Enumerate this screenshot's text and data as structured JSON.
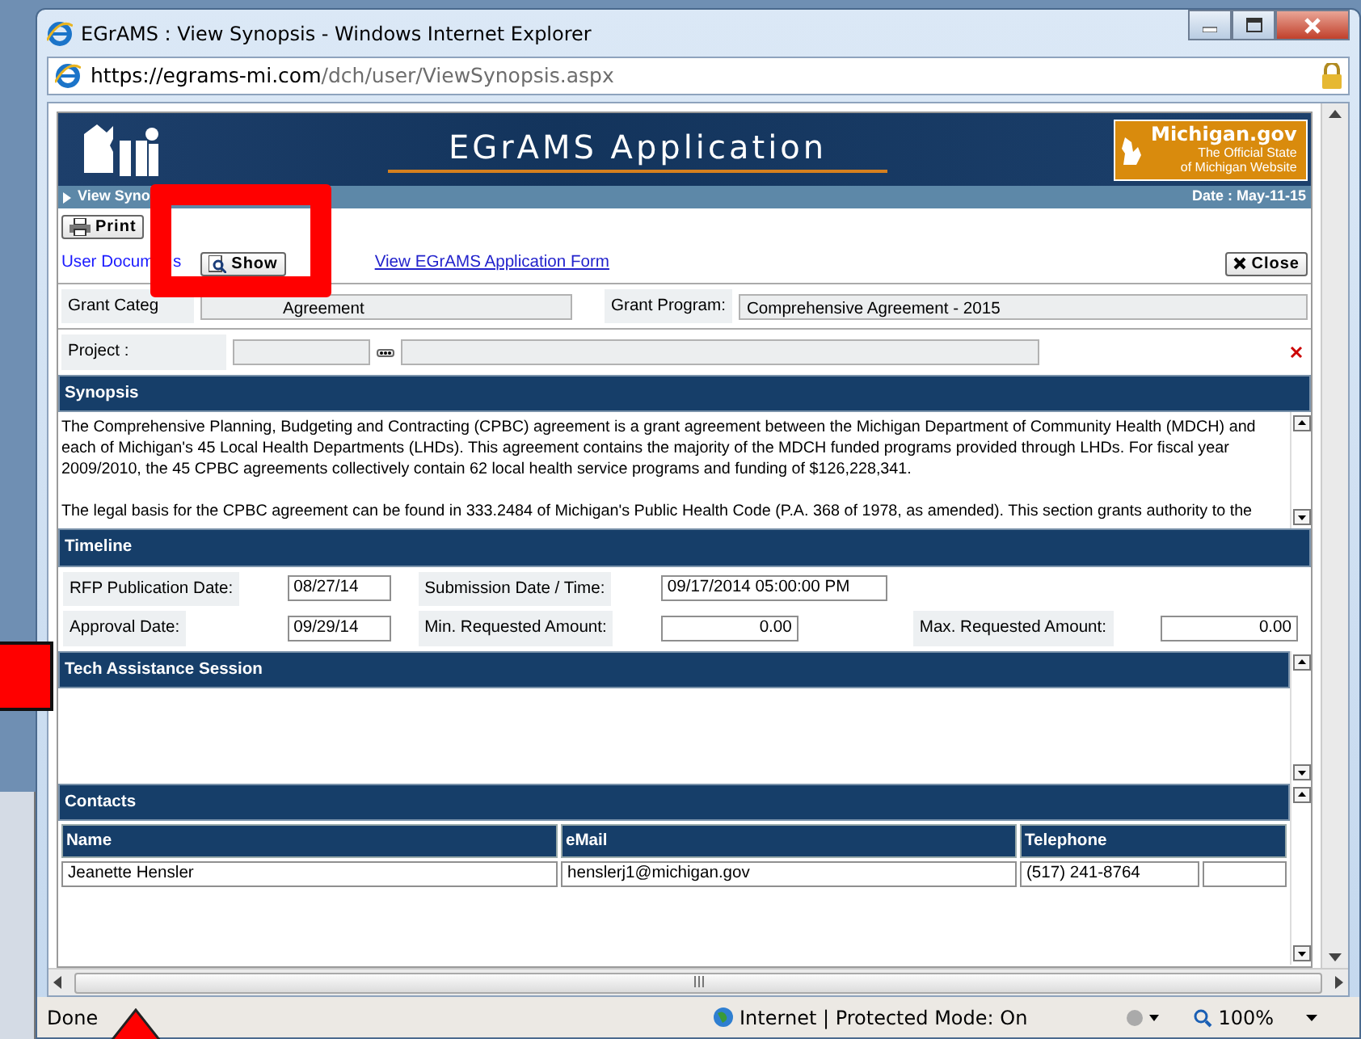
{
  "window": {
    "title": "EGrAMS : View Synopsis - Windows Internet Explorer",
    "address_host": "https://egrams-mi.com",
    "address_path": "/dch/user/ViewSynopsis.aspx"
  },
  "banner": {
    "title": "EGrAMS Application",
    "logo_title": "Michigan.gov",
    "logo_lines": [
      "The Official State",
      "of Michigan Website"
    ]
  },
  "subbar": {
    "page": "View Syno",
    "date": "Date : May-11-15"
  },
  "toolbar": {
    "print": "Print",
    "user_documents": "User Docum",
    "user_documents_tail": "s",
    "show": "Show",
    "form_link": "View EGrAMS Application Form",
    "close": "Close"
  },
  "grant": {
    "category_label": "Grant Categ",
    "category_value": "Agreement",
    "program_label": "Grant Program:",
    "program_value": "Comprehensive Agreement - 2015"
  },
  "project": {
    "label": "Project :"
  },
  "synopsis": {
    "heading": "Synopsis",
    "paragraphs": [
      "The Comprehensive Planning, Budgeting and Contracting (CPBC) agreement is a grant agreement between the Michigan Department of Community Health (MDCH) and each of Michigan's 45 Local Health Departments (LHDs). This agreement contains the majority of the MDCH funded programs provided through LHDs. For fiscal year 2009/2010, the 45 CPBC agreements collectively contain 62 local health service programs and funding of $126,228,341.",
      "The legal basis for the CPBC agreement can be found in 333.2484 of Michigan's Public Health Code (P.A. 368 of 1978, as amended). This section grants authority to the"
    ]
  },
  "timeline": {
    "heading": "Timeline",
    "rows": [
      [
        {
          "label": "RFP Publication Date:",
          "value": "08/27/14",
          "kind": "date"
        },
        {
          "label": "Submission Date / Time:",
          "value": "09/17/2014 05:00:00 PM",
          "kind": "datetime"
        }
      ],
      [
        {
          "label": "Approval Date:",
          "value": "09/29/14",
          "kind": "date"
        },
        {
          "label": "Min. Requested Amount:",
          "value": "0.00",
          "kind": "amount"
        },
        {
          "label": "Max. Requested Amount:",
          "value": "0.00",
          "kind": "amount"
        }
      ]
    ]
  },
  "tech_assistance": {
    "heading": "Tech Assistance Session"
  },
  "contacts": {
    "heading": "Contacts",
    "columns": [
      "Name",
      "eMail",
      "Telephone"
    ],
    "rows": [
      [
        "Jeanette Hensler",
        "henslerj1@michigan.gov",
        "(517) 241-8764"
      ]
    ]
  },
  "status_bar": {
    "text": "Done",
    "zone": "Internet | Protected Mode: On",
    "zoom": "100%"
  }
}
